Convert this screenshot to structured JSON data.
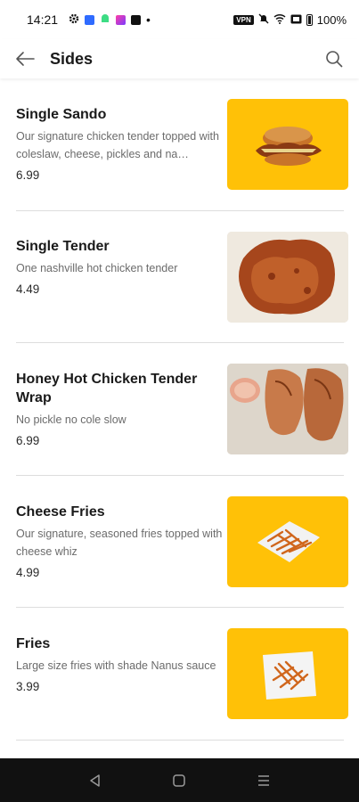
{
  "status_bar": {
    "time": "14:21",
    "battery_text": "100%",
    "vpn_label": "VPN",
    "icons": [
      "settings-icon",
      "app-icon-blue",
      "android-icon",
      "app-icon-purple",
      "app-icon-dark",
      "dot-icon",
      "vpn-icon",
      "mute-icon",
      "wifi-icon",
      "nfc-icon",
      "battery-icon"
    ]
  },
  "app_bar": {
    "title": "Sides",
    "back_icon": "arrow-left-icon",
    "search_icon": "search-icon"
  },
  "colors": {
    "thumb_yellow": "#FFC107",
    "nav_bar": "#111111",
    "divider": "#dddddd"
  },
  "items": [
    {
      "name": "Single Sando",
      "description": "Our signature chicken tender topped with coleslaw, cheese, pickles and na…",
      "price": "6.99",
      "image": "chicken-sandwich-image"
    },
    {
      "name": "Single Tender",
      "description": "One nashville hot chicken tender",
      "price": "4.49",
      "image": "fried-chicken-tender-image"
    },
    {
      "name": "Honey Hot Chicken Tender Wrap",
      "description": "No pickle no cole slow",
      "price": "6.99",
      "image": "chicken-wrap-image"
    },
    {
      "name": "Cheese Fries",
      "description": "Our signature, seasoned fries topped with cheese whiz",
      "price": "4.99",
      "image": "cheese-fries-image"
    },
    {
      "name": "Fries",
      "description": "Large size fries with shade Nanus sauce",
      "price": "3.99",
      "image": "fries-image"
    }
  ],
  "nav_bar": {
    "icons": [
      "nav-back-icon",
      "nav-home-icon",
      "nav-menu-icon"
    ]
  }
}
